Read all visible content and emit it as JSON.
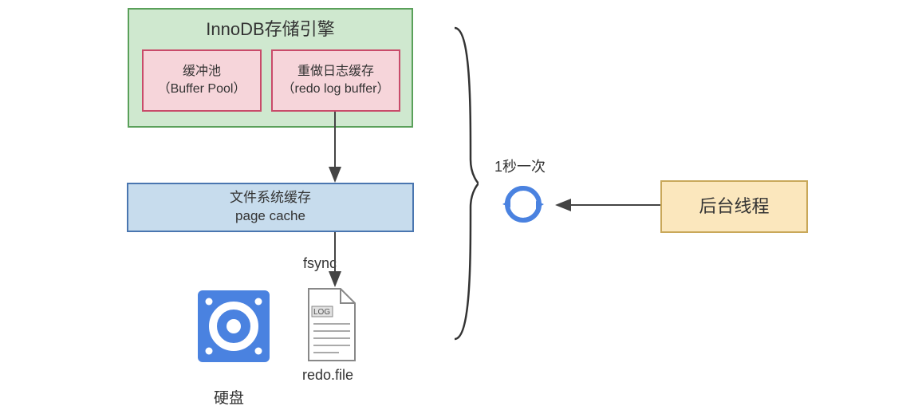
{
  "engine": {
    "title": "InnoDB存储引擎",
    "buffer_pool": {
      "line1": "缓冲池",
      "line2": "（Buffer Pool）"
    },
    "redo_buffer": {
      "line1": "重做日志缓存",
      "line2": "（redo log buffer）"
    }
  },
  "page_cache": {
    "line1": "文件系统缓存",
    "line2": "page cache"
  },
  "fsync_label": "fsync",
  "redo_file": "redo.file",
  "log_tag": "LOG",
  "hard_disk": "硬盘",
  "frequency": "1秒一次",
  "bg_thread": "后台线程",
  "colors": {
    "engine_border": "#5aa05a",
    "engine_fill": "#cfe8cf",
    "pool_border": "#c94b6a",
    "pool_fill": "#f6d5da",
    "page_cache_border": "#4a76b0",
    "page_cache_fill": "#c7dced",
    "bg_thread_border": "#c9a85a",
    "bg_thread_fill": "#fbe7bd",
    "arrow": "#444444",
    "cycle": "#4a82e0",
    "disk": "#4a82e0"
  }
}
